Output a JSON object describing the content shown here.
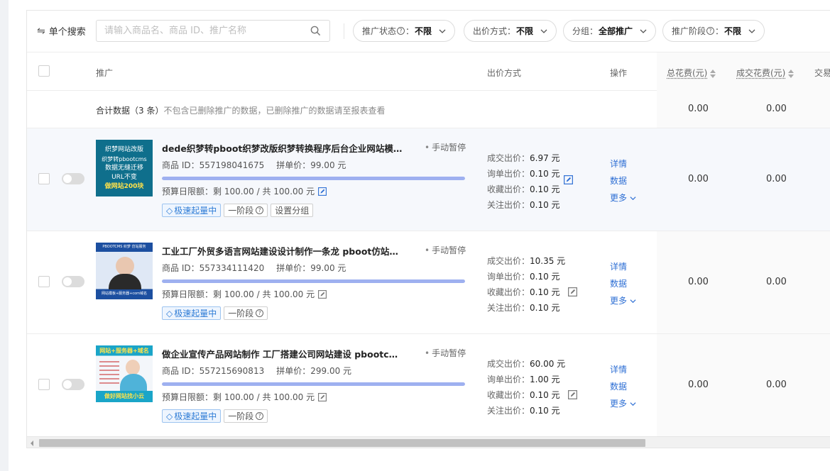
{
  "filters": {
    "search_mode": "单个搜索",
    "search_placeholder": "请输入商品名、商品 ID、推广名称",
    "pills": [
      {
        "label": "推广状态",
        "value": "不限",
        "help": true
      },
      {
        "label": "出价方式：",
        "value": "不限",
        "help": false
      },
      {
        "label": "分组：",
        "value": "全部推广",
        "help": false
      },
      {
        "label": "推广阶段",
        "value": "不限",
        "help": true
      }
    ],
    "pill_colon": "："
  },
  "table": {
    "headers": {
      "promotion": "推广",
      "bid_method": "出价方式",
      "operation": "操作",
      "total_cost": "总花费(元)",
      "deal_cost": "成交花费(元)",
      "trade": "交易"
    },
    "summary": {
      "label": "合计数据（3 条）",
      "note": "不包含已删除推广的数据，已删除推广的数据请至报表查看",
      "total_cost": "0.00",
      "deal_cost": "0.00"
    },
    "rows": [
      {
        "title": "dede织梦转pboot织梦改版织梦转换程序后台企业网站模板定制",
        "status": "手动暂停",
        "product_id": "商品 ID：557198041675",
        "group_price": "拼单价：99.00 元",
        "progress": 1.0,
        "budget": "预算日限额：剩 100.00 / 共 100.00 元",
        "tags": [
          "极速起量中",
          "一阶段",
          "设置分组"
        ],
        "bids": {
          "deal": "6.97 元",
          "inquiry": "0.10 元",
          "favorite": "0.10 元",
          "follow": "0.10 元"
        },
        "total_cost": "0.00",
        "deal_cost": "0.00",
        "thumb": {
          "lines": [
            "织梦网站改版",
            "织梦转pbootcms",
            "数据无缝迁移",
            "URL不变",
            "做网站200块"
          ]
        }
      },
      {
        "title": "工业工厂外贸多语言网站建设设计制作一条龙 pboot仿站扒站...",
        "status": "手动暂停",
        "product_id": "商品 ID：557334111420",
        "group_price": "拼单价：99.00 元",
        "progress": 1.0,
        "budget": "预算日限额：剩 100.00 / 共 100.00 元",
        "tags": [
          "极速起量中",
          "一阶段"
        ],
        "bids": {
          "deal": "10.35 元",
          "inquiry": "0.10 元",
          "favorite": "0.10 元",
          "follow": "0.10 元"
        },
        "total_cost": "0.00",
        "deal_cost": "0.00",
        "thumb": {
          "lines": [
            "PBOOTCMS 织梦 仿站服务",
            "网站模板+服务器+com域名"
          ]
        }
      },
      {
        "title": "做企业宣传产品网站制作 工厂搭建公司网站建设 pbootcms扒...",
        "status": "手动暂停",
        "product_id": "商品 ID：557215690813",
        "group_price": "拼单价：299.00 元",
        "progress": 1.0,
        "budget": "预算日限额：剩 100.00 / 共 100.00 元",
        "tags": [
          "极速起量中",
          "一阶段"
        ],
        "bids": {
          "deal": "60.00 元",
          "inquiry": "1.00 元",
          "favorite": "0.10 元",
          "follow": "0.10 元"
        },
        "total_cost": "0.00",
        "deal_cost": "0.00",
        "thumb": {
          "lines": [
            "网站+服务器+域名",
            "做好网站找小云"
          ]
        }
      }
    ],
    "bid_labels": {
      "deal": "成交出价：",
      "inquiry": "询单出价：",
      "favorite": "收藏出价：",
      "follow": "关注出价："
    },
    "ops": {
      "detail": "详情",
      "data": "数据",
      "more": "更多"
    }
  },
  "colors": {
    "accent": "#2e6fd4",
    "progress": "#9eb0f0",
    "tag_blue": "#2e7cd6"
  }
}
